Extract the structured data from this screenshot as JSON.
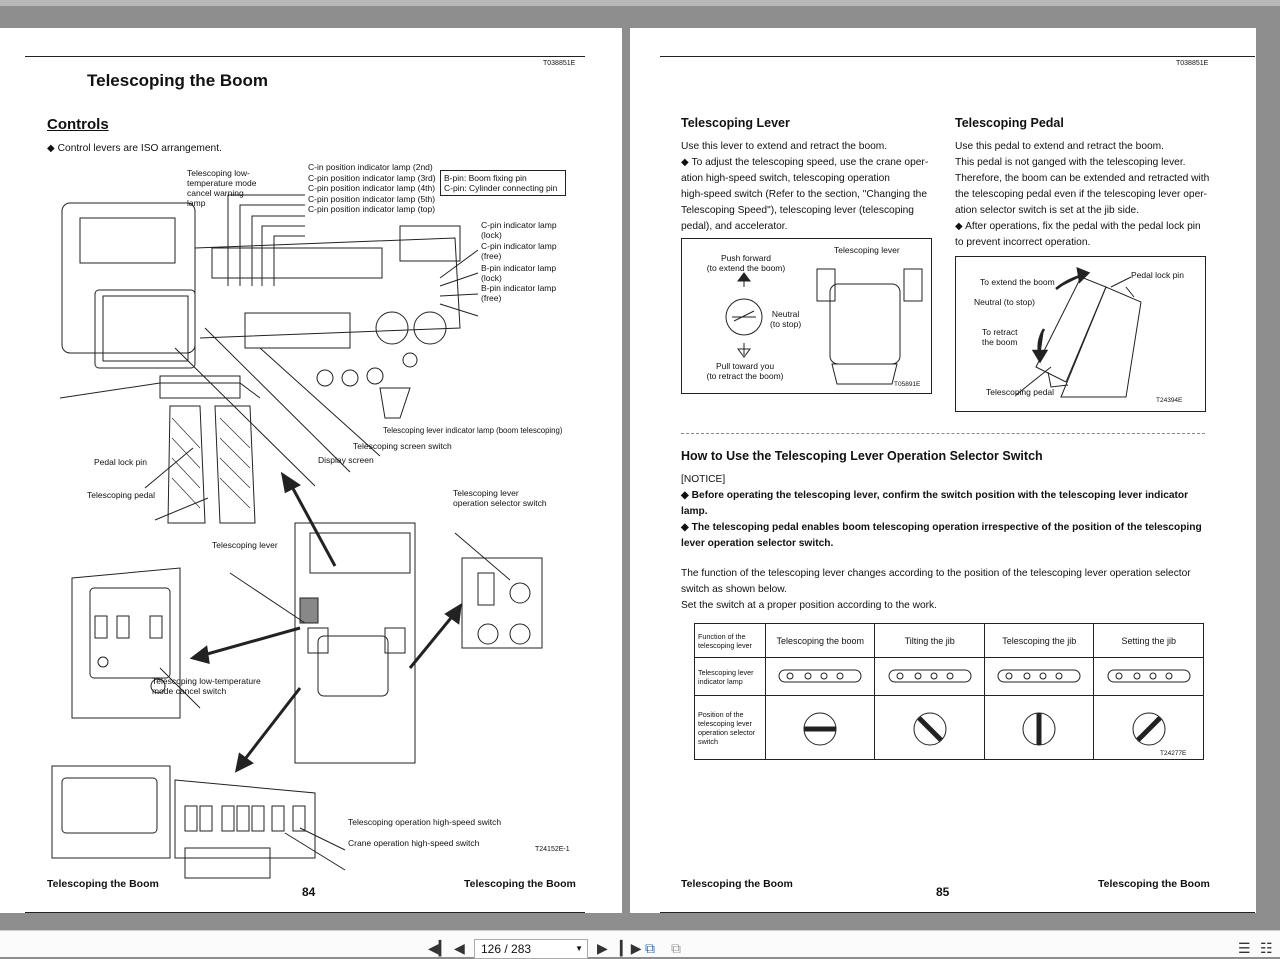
{
  "left_page": {
    "code": "T038851E",
    "title": "Telescoping the Boom",
    "section": "Controls",
    "note": "◆ Control levers are ISO arrangement.",
    "callouts": {
      "c_in_2nd": "C-in position indicator lamp (2nd)",
      "c_pin_3rd": "C-pin position indicator lamp (3rd)",
      "c_pin_4th": "C-pin position indicator lamp (4th)",
      "c_pin_5th": "C-pin position indicator lamp (5th)",
      "c_pin_top": "C-pin position indicator lamp (top)",
      "b_pin_def": "B-pin: Boom fixing pin",
      "c_pin_def": "C-pin: Cylinder connecting pin",
      "low_temp_warning": "Telescoping low-temperature mode cancel warning lamp",
      "c_pin_lock": "C-pin indicator lamp (lock)",
      "c_pin_free": "C-pin indicator lamp (free)",
      "b_pin_lock": "B-pin indicator lamp (lock)",
      "b_pin_free": "B-pin indicator lamp (free)",
      "lever_indicator": "Telescoping lever indicator lamp (boom telescoping)",
      "screen_switch": "Telescoping screen switch",
      "display_screen": "Display screen",
      "pedal_lock_pin": "Pedal lock pin",
      "telescoping_pedal": "Telescoping pedal",
      "lever_selector": "Telescoping lever operation selector switch",
      "telescoping_lever": "Telescoping lever",
      "low_temp_cancel": "Telescoping low-temperature mode cancel switch",
      "tele_high_speed": "Telescoping operation high-speed switch",
      "crane_high_speed": "Crane operation high-speed switch"
    },
    "figure_code": "T24152E-1",
    "footer_left": "Telescoping the Boom",
    "page_number": "84",
    "footer_right": "Telescoping the Boom"
  },
  "right_page": {
    "code": "T038851E",
    "lever_heading": "Telescoping Lever",
    "lever_p1": "Use this lever to extend and retract the boom.",
    "lever_p2": "◆ To adjust the telescoping speed, use the crane oper-",
    "lever_p3": "ation high-speed switch, telescoping operation",
    "lever_p4": "high-speed switch (Refer to the section, \"Changing the",
    "lever_p5": "Telescoping Speed\"), telescoping lever (telescoping",
    "lever_p6": "pedal), and accelerator.",
    "lever_fig": {
      "push_forward": "Push forward",
      "extend": "(to extend the boom)",
      "neutral": "Neutral",
      "to_stop": "(to stop)",
      "pull_toward": "Pull toward you",
      "retract": "(to retract the boom)",
      "lever_label": "Telescoping lever",
      "code": "T05891E"
    },
    "pedal_heading": "Telescoping Pedal",
    "pedal_p1": "Use this pedal to extend and retract the boom.",
    "pedal_p2": "This pedal is not ganged with the telescoping lever.",
    "pedal_p3": "Therefore, the boom can be extended and retracted with",
    "pedal_p4": "the telescoping pedal even if the telescoping lever oper-",
    "pedal_p5": "ation selector switch is set at the jib side.",
    "pedal_p6": "◆ After operations, fix the pedal with the pedal lock pin",
    "pedal_p7": "to prevent incorrect operation.",
    "pedal_fig": {
      "extend": "To extend the boom",
      "neutral": "Neutral (to stop)",
      "retract1": "To retract",
      "retract2": "the boom",
      "lock_pin": "Pedal lock pin",
      "pedal": "Telescoping pedal",
      "code": "T24394E"
    },
    "howto_heading": "How to Use the Telescoping Lever Operation Selector Switch",
    "notice": "[NOTICE]",
    "notice1a": "◆ Before operating the telescoping lever, confirm the switch position with the telescoping lever indicator",
    "notice1b": "lamp.",
    "notice2a": "◆ The telescoping pedal enables boom telescoping operation irrespective of the position of the telescoping",
    "notice2b": "lever operation selector switch.",
    "func1": "The function of the telescoping lever changes according to the position of the telescoping lever operation selector",
    "func2": "switch as shown below.",
    "func3": "Set the switch at a proper position according to the work.",
    "table": {
      "row_function": "Function of the telescoping lever",
      "row_indicator": "Telescoping lever indicator lamp",
      "row_position": "Position of the telescoping lever operation selector switch",
      "columns": [
        "Telescoping the boom",
        "Tilting the jib",
        "Telescoping the jib",
        "Setting the jib"
      ],
      "code": "T24277E"
    },
    "footer_left": "Telescoping the Boom",
    "page_number": "85",
    "footer_right": "Telescoping the Boom"
  },
  "toolbar": {
    "page_indicator": "126 / 283"
  }
}
